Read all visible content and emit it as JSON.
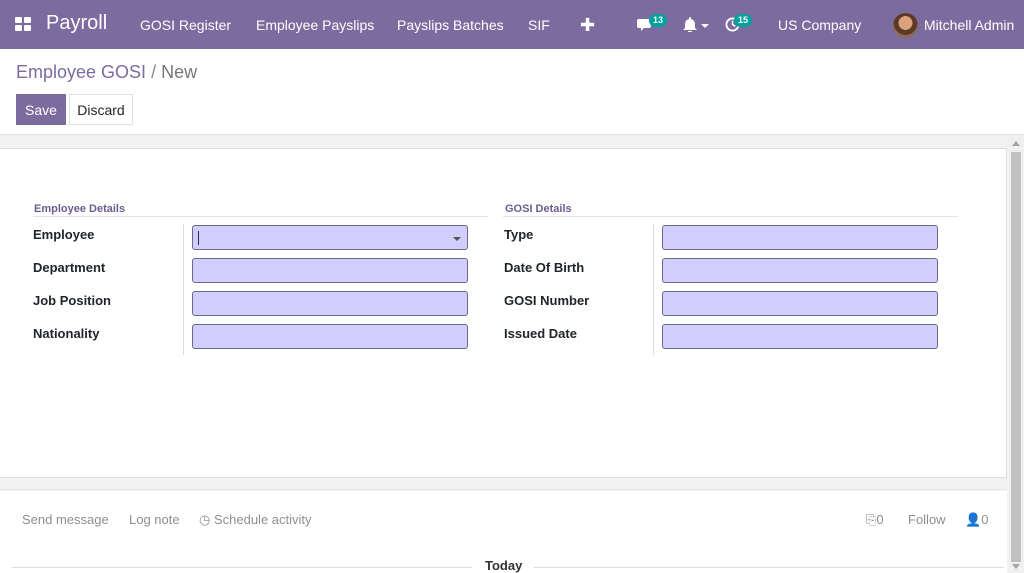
{
  "navbar": {
    "brand": "Payroll",
    "menu": [
      "GOSI Register",
      "Employee Payslips",
      "Payslips Batches",
      "SIF"
    ],
    "messages_count": "13",
    "activities_count": "15",
    "company": "US Company",
    "user": "Mitchell Admin",
    "accent_color": "#7c6b9f",
    "badge_color": "#00a09d"
  },
  "breadcrumb": {
    "parent": "Employee GOSI",
    "separator": "/",
    "current": "New"
  },
  "actions": {
    "save": "Save",
    "discard": "Discard"
  },
  "form": {
    "employee_section": {
      "title": "Employee Details",
      "fields": {
        "employee": "Employee",
        "department": "Department",
        "job_position": "Job Position",
        "nationality": "Nationality"
      }
    },
    "gosi_section": {
      "title": "GOSI Details",
      "fields": {
        "type": "Type",
        "date_of_birth": "Date Of Birth",
        "gosi_number": "GOSI Number",
        "issued_date": "Issued Date"
      }
    },
    "input_color": "#d1cdfc"
  },
  "chatter": {
    "send_message": "Send message",
    "log_note": "Log note",
    "schedule_activity": "Schedule activity",
    "attachments": "0",
    "follow": "Follow",
    "followers": "0",
    "today": "Today"
  }
}
